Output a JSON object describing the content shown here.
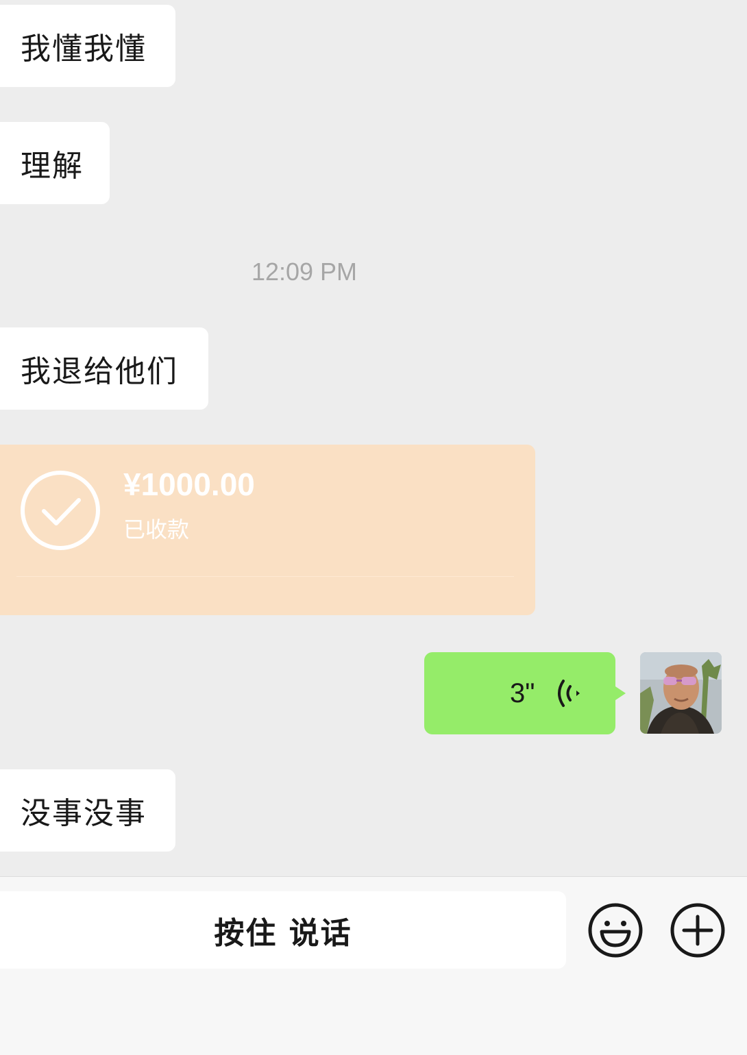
{
  "messages": {
    "m1": "我懂我懂",
    "m2": "理解",
    "timestamp": "12:09 PM",
    "m3": "我退给他们",
    "transfer": {
      "amount": "¥1000.00",
      "status": "已收款"
    },
    "voice": {
      "duration": "3\""
    },
    "m4": "没事没事"
  },
  "input": {
    "hold_to_talk": "按住 说话"
  },
  "colors": {
    "chat_bg": "#ededed",
    "incoming_bubble": "#ffffff",
    "outgoing_bubble": "#95ec69",
    "transfer_received": "#fae0c4"
  },
  "icons": {
    "transfer": "check-circle-icon",
    "voice": "voice-wave-icon",
    "emoji": "emoji-icon",
    "plus": "plus-circle-icon"
  }
}
